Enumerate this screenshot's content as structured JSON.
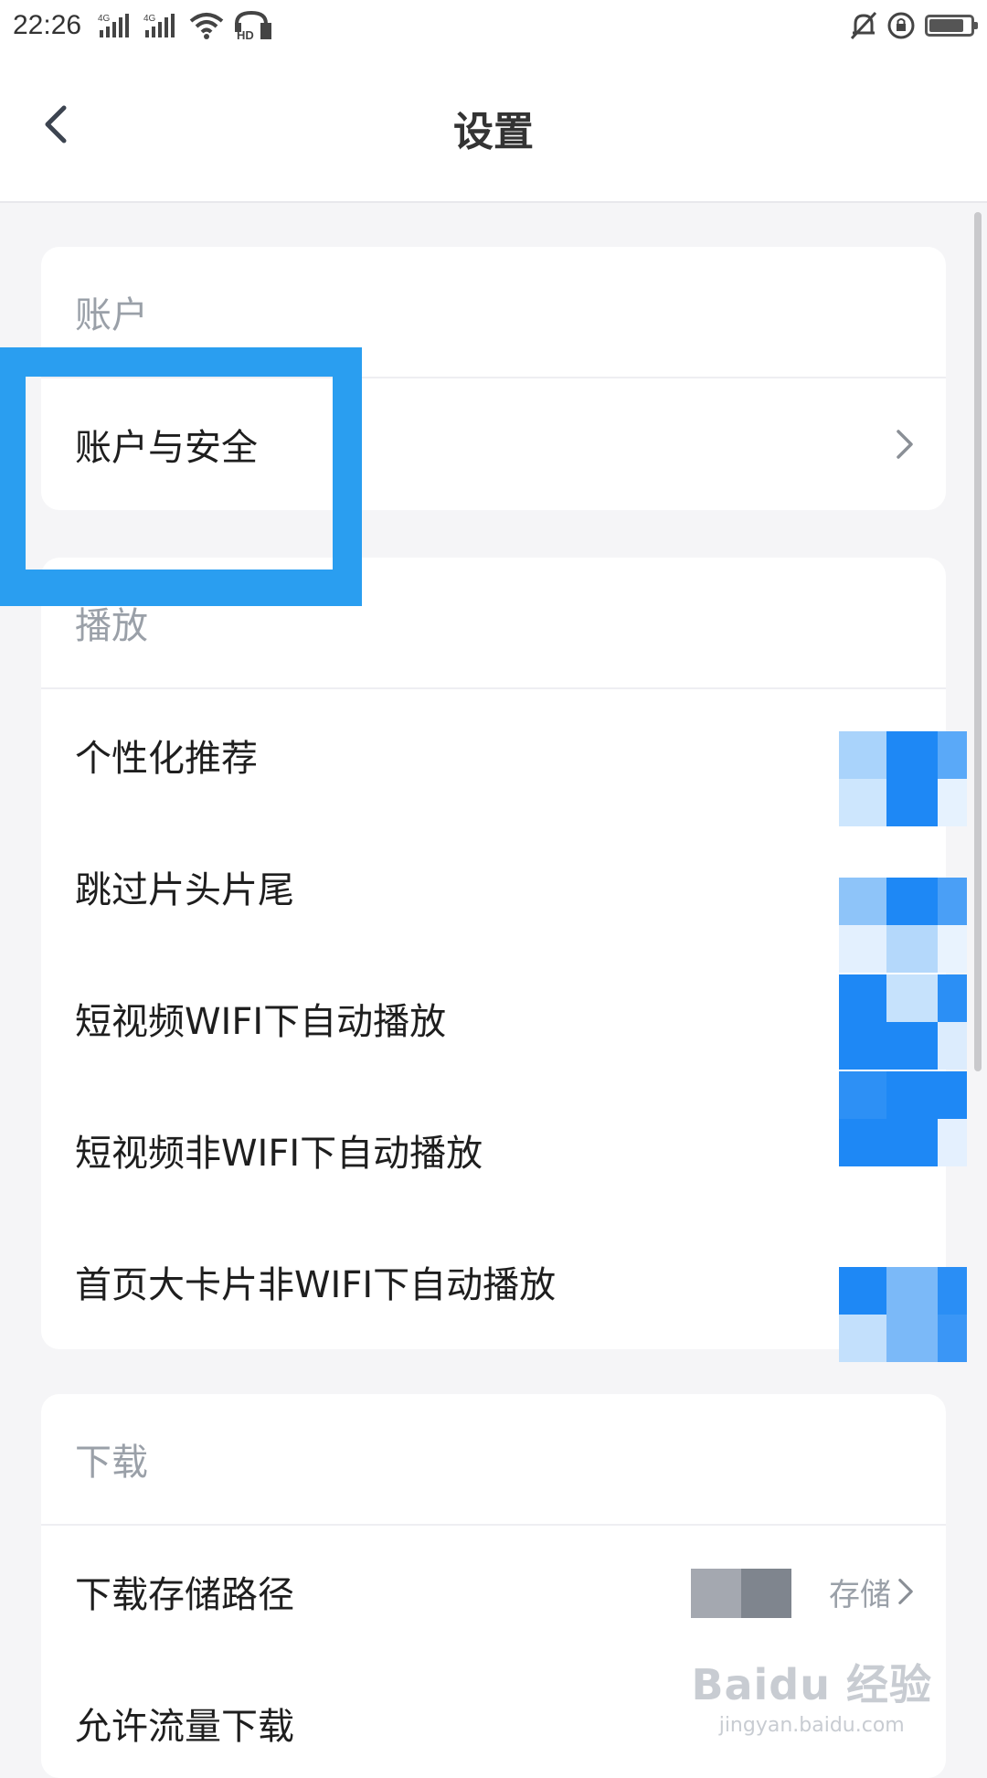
{
  "status_bar": {
    "time": "22:26",
    "signal1_label": "4G",
    "signal2_label": "4G",
    "hd_label": "HD",
    "icons": [
      "signal-4g-icon",
      "signal-4g-icon",
      "wifi-icon",
      "hd-call-icon",
      "mute-bell-icon",
      "rotation-lock-icon",
      "battery-icon"
    ],
    "battery_level": 0.85
  },
  "header": {
    "title": "设置",
    "back_icon": "chevron-left-icon"
  },
  "sections": {
    "account": {
      "title": "账户",
      "items": [
        {
          "label": "账户与安全",
          "control": "chevron-right-icon"
        }
      ]
    },
    "playback": {
      "title": "播放",
      "items": [
        {
          "label": "个性化推荐",
          "control": "toggle"
        },
        {
          "label": "跳过片头片尾",
          "control": "toggle"
        },
        {
          "label": "短视频WIFI下自动播放",
          "control": "toggle"
        },
        {
          "label": "短视频非WIFI下自动播放",
          "control": "toggle"
        },
        {
          "label": "首页大卡片非WIFI下自动播放",
          "control": "toggle"
        }
      ]
    },
    "download": {
      "title": "下载",
      "items": [
        {
          "label": "下载存储路径",
          "value_fragment": "存储",
          "control": "chevron-right-icon"
        },
        {
          "label": "允许流量下载",
          "control": "toggle"
        }
      ]
    }
  },
  "watermark": {
    "main": "Baidu 经验",
    "sub": "jingyan.baidu.com"
  },
  "colors": {
    "accent": "#2a9ef0",
    "toggle_blue": "#1e88f5",
    "background": "#f5f5f7",
    "card": "#ffffff",
    "section_title": "#9aa0a8"
  }
}
